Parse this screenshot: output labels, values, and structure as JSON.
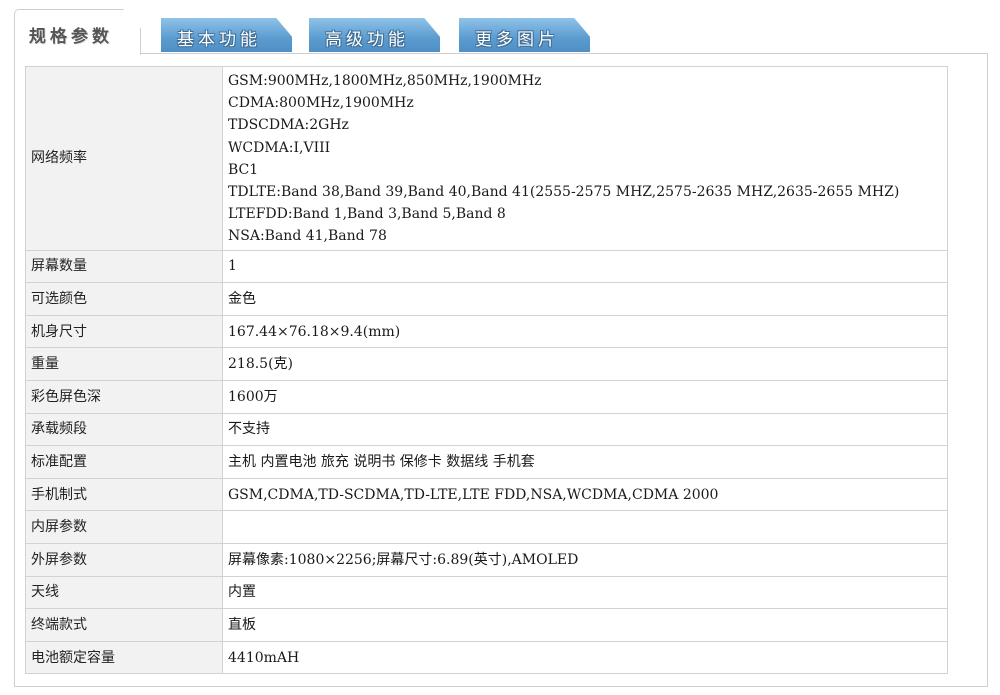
{
  "tabs": [
    {
      "label": "规格参数",
      "active": true
    },
    {
      "label": "基本功能",
      "active": false
    },
    {
      "label": "高级功能",
      "active": false
    },
    {
      "label": "更多图片",
      "active": false
    }
  ],
  "specs": {
    "network": {
      "label": "网络频率",
      "lines": [
        "GSM:900MHz,1800MHz,850MHz,1900MHz",
        "CDMA:800MHz,1900MHz",
        "TDSCDMA:2GHz",
        "WCDMA:I,VIII",
        "BC1",
        "TDLTE:Band 38,Band 39,Band 40,Band 41(2555-2575 MHZ,2575-2635 MHZ,2635-2655 MHZ)",
        "LTEFDD:Band 1,Band 3,Band 5,Band 8",
        "NSA:Band 41,Band 78"
      ]
    },
    "rows": [
      {
        "label": "屏幕数量",
        "value": "1"
      },
      {
        "label": "可选颜色",
        "value": "金色"
      },
      {
        "label": "机身尺寸",
        "value": "167.44×76.18×9.4(mm)"
      },
      {
        "label": "重量",
        "value": "218.5(克)"
      },
      {
        "label": "彩色屏色深",
        "value": "1600万"
      },
      {
        "label": "承载频段",
        "value": "不支持"
      },
      {
        "label": "标准配置",
        "value": "主机 内置电池 旅充 说明书 保修卡 数据线 手机套"
      },
      {
        "label": "手机制式",
        "value": "GSM,CDMA,TD-SCDMA,TD-LTE,LTE FDD,NSA,WCDMA,CDMA 2000"
      },
      {
        "label": "内屏参数",
        "value": ""
      },
      {
        "label": "外屏参数",
        "value": "屏幕像素:1080×2256;屏幕尺寸:6.89(英寸),AMOLED"
      },
      {
        "label": "天线",
        "value": "内置"
      },
      {
        "label": "终端款式",
        "value": "直板"
      },
      {
        "label": "电池额定容量",
        "value": "4410mAH"
      }
    ]
  },
  "colors": {
    "tab_blue": "#5b9bd0",
    "label_bg": "#f2f2f2",
    "border": "#d2d2d2"
  }
}
